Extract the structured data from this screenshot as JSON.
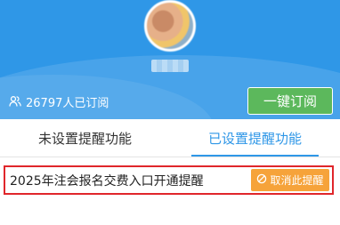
{
  "header": {
    "subscriber_count_text": "26797人已订阅",
    "subscribe_button": "一键订阅"
  },
  "tabs": [
    {
      "label": "未设置提醒功能",
      "active": false
    },
    {
      "label": "已设置提醒功能",
      "active": true
    }
  ],
  "reminders": [
    {
      "title": "2025年注会报名交费入口开通提醒",
      "action": "取消此提醒"
    }
  ],
  "colors": {
    "header_bg": "#2f97e7",
    "subscribe_green": "#5cb85c",
    "active_tab": "#2f97e7",
    "cancel_orange": "#f6a33a",
    "highlight_red": "#e0262b"
  },
  "icons": {
    "subscribers": "users-icon",
    "cancel": "ban-icon"
  }
}
